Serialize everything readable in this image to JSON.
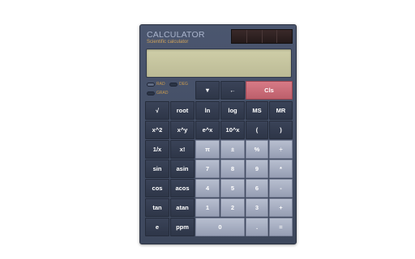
{
  "header": {
    "title": "CALCULATOR",
    "subtitle": "Scientific calculator"
  },
  "display": {
    "value": ""
  },
  "modes": [
    {
      "label": "RAD",
      "active": true
    },
    {
      "label": "DEG",
      "active": false
    },
    {
      "label": "GRAD",
      "active": false
    }
  ],
  "buttons": {
    "top": [
      "▼",
      "←",
      "Cls"
    ],
    "rows": [
      [
        "√",
        "root",
        "ln",
        "log",
        "MS",
        "MR"
      ],
      [
        "x^2",
        "x^y",
        "e^x",
        "10^x",
        "(",
        ")"
      ],
      [
        "1/x",
        "x!",
        "π",
        "±",
        "%",
        "÷"
      ],
      [
        "sin",
        "asin",
        "7",
        "8",
        "9",
        "*"
      ],
      [
        "cos",
        "acos",
        "4",
        "5",
        "6",
        "-"
      ],
      [
        "tan",
        "atan",
        "1",
        "2",
        "3",
        "+"
      ],
      [
        "e",
        "ppm",
        "0",
        ".",
        "="
      ]
    ]
  },
  "colors": {
    "body": "#46506a",
    "display": "#c9c8a2",
    "key_dark": "#343d51",
    "key_light": "#a9b0c3",
    "key_clear": "#cc6d7a",
    "subtitle": "#d0a35a"
  }
}
